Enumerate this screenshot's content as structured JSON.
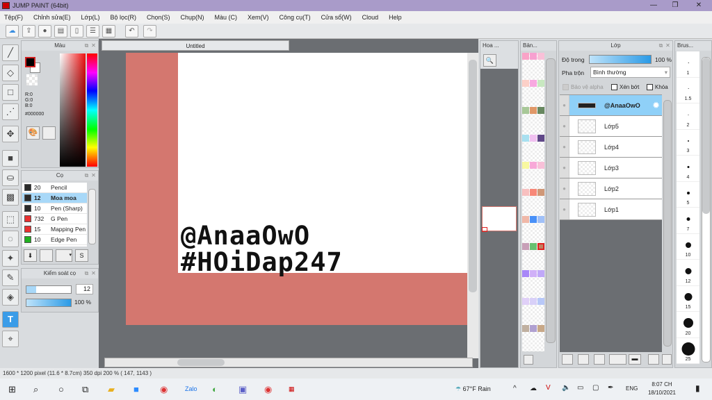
{
  "title": "JUMP PAINT (64bit)",
  "menu": [
    "Tệp(F)",
    "Chỉnh sửa(E)",
    "Lớp(L)",
    "Bộ lọc(R)",
    "Chọn(S)",
    "Chụp(N)",
    "Màu (C)",
    "Xem(V)",
    "Công cụ(T)",
    "Cửa sổ(W)",
    "Cloud",
    "Help"
  ],
  "color_panel": {
    "title": "Màu",
    "r": "R:0",
    "g": "G:0",
    "b": "B:0",
    "hex": "#000000",
    "fg": "#000000",
    "bg": "#ffffff"
  },
  "brush_panel": {
    "title": "Cọ",
    "items": [
      {
        "size": "20",
        "name": "Pencil",
        "color": "#2a2a2a"
      },
      {
        "size": "12",
        "name": "Moa moa",
        "color": "#2a2a2a",
        "selected": true
      },
      {
        "size": "10",
        "name": "Pen (Sharp)",
        "color": "#2a2a2a"
      },
      {
        "size": "732",
        "name": "G Pen",
        "color": "#e83030"
      },
      {
        "size": "15",
        "name": "Mapping Pen",
        "color": "#e83030"
      },
      {
        "size": "10",
        "name": "Edge Pen",
        "color": "#20b020"
      }
    ]
  },
  "brush_control": {
    "title": "Kiểm soát cọ",
    "size": "12",
    "opacity": "100 %",
    "size_fraction": 0.12,
    "opacity_fraction": 1.0
  },
  "document": {
    "tab": "Untitled",
    "line1": "@AnaaOwO",
    "line2": "#HOiDap247",
    "canvas_color": "#d4776f"
  },
  "navigator": {
    "title": "Hoa ..."
  },
  "palette": {
    "title": "Bản...",
    "colors": [
      "#f9a3c7",
      "#f7a0d0",
      "#f9c0d8",
      "#fcd0c8",
      "#f8a8e0",
      "#c8e8c0",
      "#a8c898",
      "#e09868",
      "#688860",
      "#a8e0f0",
      "#f0c0f0",
      "#604888",
      "#f8f8a0",
      "#f8a8d8",
      "#f8c0d8",
      "#f8c0c0",
      "#f88878",
      "#d09878",
      "#f0b8a8",
      "#4890f8",
      "#a0c0f8",
      "#c8a0b8",
      "#68c070",
      "#c08060",
      "#a888f8",
      "#d0b0f8",
      "#c0a8f8",
      "#e0d0f8",
      "#d8d0f8",
      "#b8c8f8",
      "#c0b0a0",
      "#b0a0d0",
      "#c8a888"
    ]
  },
  "layers": {
    "title": "Lớp",
    "opacity_label": "Độ trong",
    "opacity": "100 %",
    "blend_label": "Pha trộn",
    "blend": "Bình thường",
    "protect_alpha": "Bảo vệ alpha",
    "clip": "Xén bớt",
    "lock": "Khóa",
    "items": [
      {
        "name": "@AnaaOwO",
        "selected": true
      },
      {
        "name": "Lớp5"
      },
      {
        "name": "Lớp4"
      },
      {
        "name": "Lớp3"
      },
      {
        "name": "Lớp2"
      },
      {
        "name": "Lớp1"
      }
    ]
  },
  "brush_size_panel": {
    "title": "Brus...",
    "sizes": [
      "1",
      "1.5",
      "2",
      "3",
      "4",
      "5",
      "7",
      "10",
      "12",
      "15",
      "20",
      "25"
    ]
  },
  "status": "1600 * 1200 pixel  (11.6 * 8.7cm)  350 dpi  200 %  ( 147, 1143 )",
  "taskbar": {
    "weather": "67°F  Rain",
    "lang": "ENG",
    "time": "8:07 CH",
    "date": "18/10/2021"
  }
}
